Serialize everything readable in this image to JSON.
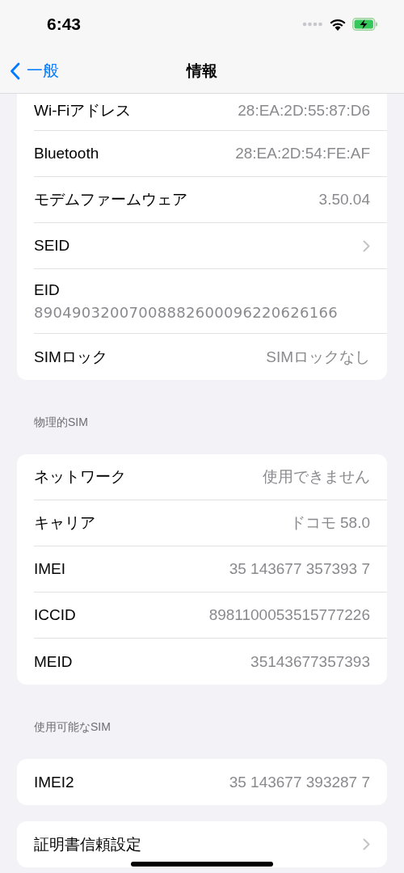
{
  "status_bar": {
    "time": "6:43"
  },
  "nav": {
    "back": "一般",
    "title": "情報"
  },
  "groups": [
    {
      "rows": [
        {
          "kind": "value",
          "label": "Wi-Fiアドレス",
          "value": "28:EA:2D:55:87:D6"
        },
        {
          "kind": "value",
          "label": "Bluetooth",
          "value": "28:EA:2D:54:FE:AF"
        },
        {
          "kind": "value",
          "label": "モデムファームウェア",
          "value": "3.50.04"
        },
        {
          "kind": "link",
          "label": "SEID"
        },
        {
          "kind": "stacked",
          "label": "EID",
          "value": "89049032007008882600096220626166"
        },
        {
          "kind": "value",
          "label": "SIMロック",
          "value": "SIMロックなし"
        }
      ]
    },
    {
      "header": "物理的SIM",
      "rows": [
        {
          "kind": "value",
          "label": "ネットワーク",
          "value": "使用できません"
        },
        {
          "kind": "value",
          "label": "キャリア",
          "value": "ドコモ 58.0"
        },
        {
          "kind": "value",
          "label": "IMEI",
          "value": "35 143677 357393 7"
        },
        {
          "kind": "value",
          "label": "ICCID",
          "value": "8981100053515777226"
        },
        {
          "kind": "value",
          "label": "MEID",
          "value": "35143677357393"
        }
      ]
    },
    {
      "header": "使用可能なSIM",
      "rows": [
        {
          "kind": "value",
          "label": "IMEI2",
          "value": "35 143677 393287 7"
        }
      ]
    },
    {
      "rows": [
        {
          "kind": "link",
          "label": "証明書信頼設定"
        }
      ]
    }
  ]
}
